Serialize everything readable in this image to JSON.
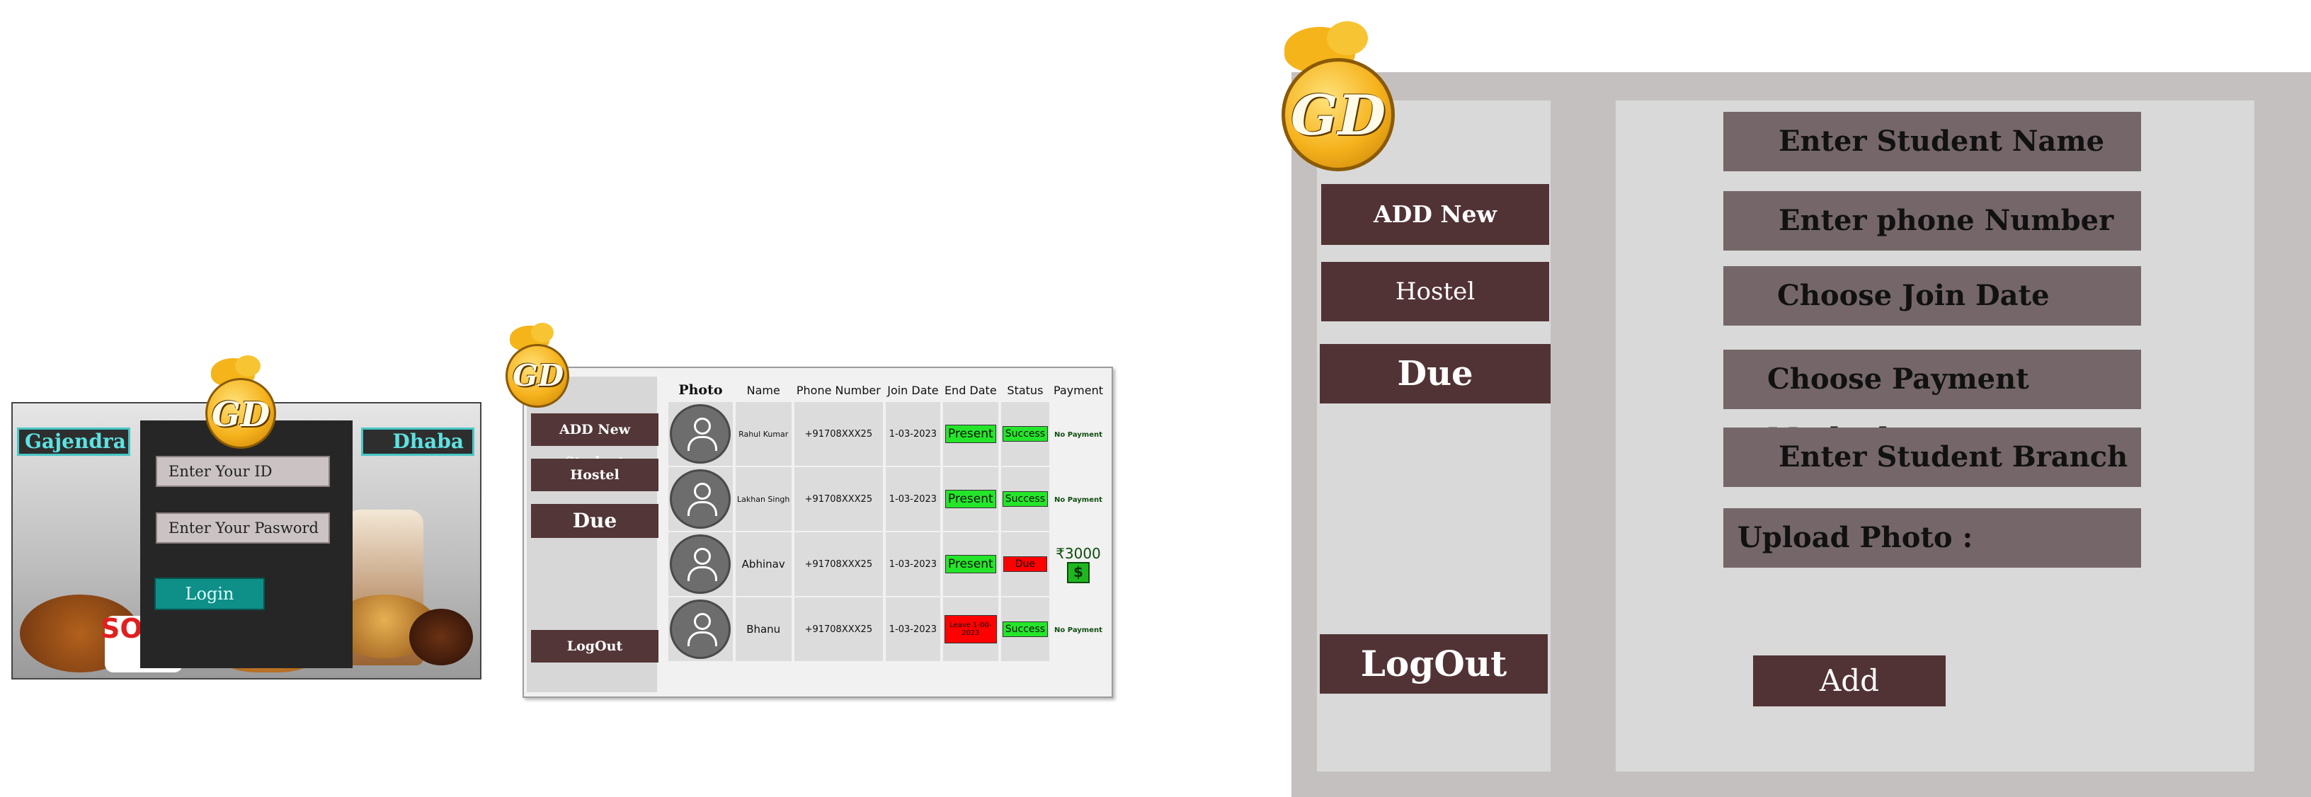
{
  "logo": {
    "text": "GD"
  },
  "login": {
    "brand_left": "Gajendra",
    "brand_right": "Dhaba",
    "id_placeholder": "Enter Your ID",
    "password_placeholder": "Enter Your Pasword",
    "login_label": "Login",
    "food_sign": "SON"
  },
  "list_view": {
    "sidebar": {
      "add_new_student": "ADD New Student",
      "hostel": "Hostel",
      "due": "Due",
      "logout": "LogOut"
    },
    "columns": [
      "Photo",
      "Name",
      "Phone Number",
      "Join Date",
      "End Date",
      "Status",
      "Payment"
    ],
    "rows": [
      {
        "name": "Rahul Kumar",
        "phone": "+91708XXX25",
        "join_date": "1-03-2023",
        "end_date": "Present",
        "end_color": "#25e52a",
        "status": "Success",
        "status_color": "#25e52a",
        "payment": "No Payment"
      },
      {
        "name": "Lakhan Singh",
        "phone": "+91708XXX25",
        "join_date": "1-03-2023",
        "end_date": "Present",
        "end_color": "#25e52a",
        "status": "Success",
        "status_color": "#25e52a",
        "payment": "No Payment"
      },
      {
        "name": "Abhinav",
        "phone": "+91708XXX25",
        "join_date": "1-03-2023",
        "end_date": "Present",
        "end_color": "#25e52a",
        "status": "Due",
        "status_color": "#ff0000",
        "payment": "₹3000",
        "payment_icon": "$"
      },
      {
        "name": "Bhanu",
        "phone": "+91708XXX25",
        "join_date": "1-03-2023",
        "end_date": "Leave 1-00-2023",
        "end_color": "#ff0000",
        "status": "Success",
        "status_color": "#25e52a",
        "payment": "No Payment"
      }
    ]
  },
  "add_view": {
    "sidebar": {
      "add_new_student": "ADD New Student",
      "hostel": "Hostel",
      "due": "Due",
      "logout": "LogOut"
    },
    "fields": {
      "student_name": "Enter Student Name",
      "phone_number": "Enter phone Number",
      "join_date": "Choose Join Date",
      "payment_method": "Choose Payment Method",
      "student_branch": "Enter Student Branch",
      "upload_photo": "Upload Photo :"
    },
    "add_label": "Add"
  },
  "colors": {
    "button_dark": "#523335",
    "field_bg": "#756769",
    "accent_teal": "#49c6c6",
    "status_green": "#25e52a",
    "status_red": "#ff0000",
    "logo_gold": "#f5b21c"
  }
}
